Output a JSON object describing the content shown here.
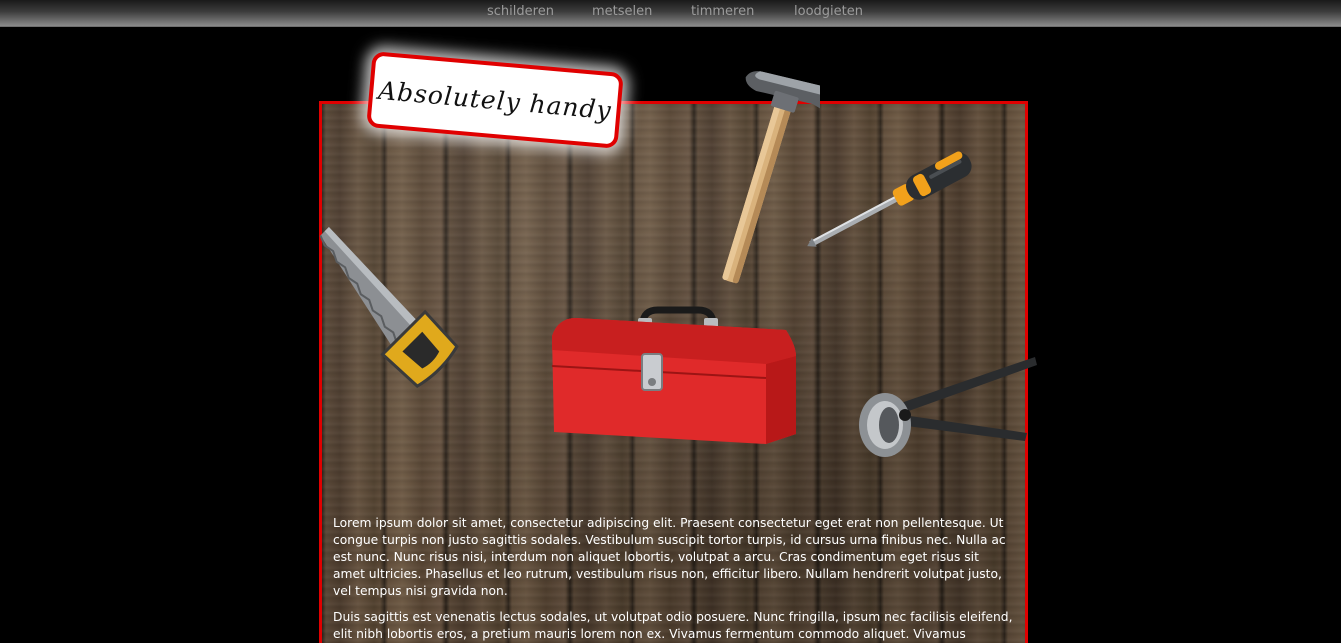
{
  "nav": {
    "items": [
      {
        "label": "schilderen"
      },
      {
        "label": "metselen"
      },
      {
        "label": "timmeren"
      },
      {
        "label": "loodgieten"
      }
    ]
  },
  "header": {
    "tag_label": "Absolutely handy"
  },
  "tools": [
    {
      "icon": "hammer-icon"
    },
    {
      "icon": "screwdriver-icon"
    },
    {
      "icon": "saw-icon"
    },
    {
      "icon": "toolbox-icon"
    },
    {
      "icon": "pincers-icon"
    }
  ],
  "content": {
    "paragraph_1": "Lorem ipsum dolor sit amet, consectetur adipiscing elit. Praesent consectetur eget erat non pellentesque. Ut congue turpis non justo sagittis sodales. Vestibulum suscipit tortor turpis, id cursus urna finibus nec. Nulla ac est nunc. Nunc risus nisi, interdum non aliquet lobortis, volutpat a arcu. Cras condimentum eget risus sit amet ultricies. Phasellus et leo rutrum, vestibulum risus non, efficitur libero. Nullam hendrerit volutpat justo, vel tempus nisi gravida non.",
    "paragraph_2": "Duis sagittis est venenatis lectus sodales, ut volutpat odio posuere. Nunc fringilla, ipsum nec facilisis eleifend, elit nibh lobortis eros, a pretium mauris lorem non ex. Vivamus fermentum commodo aliquet. Vivamus"
  },
  "colors": {
    "accent": "#e00000",
    "background": "#000000",
    "nav_text": "#9b9b9b",
    "body_text": "#ffffff"
  }
}
